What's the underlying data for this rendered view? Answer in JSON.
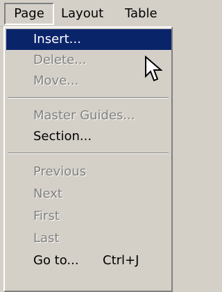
{
  "menubar": {
    "items": [
      {
        "label": "Page"
      },
      {
        "label": "Layout"
      },
      {
        "label": "Table"
      }
    ]
  },
  "menu": {
    "items": [
      {
        "label": "Insert...",
        "state": "highlighted"
      },
      {
        "label": "Delete...",
        "state": "disabled"
      },
      {
        "label": "Move...",
        "state": "disabled"
      },
      {
        "label": "Master Guides...",
        "state": "disabled"
      },
      {
        "label": "Section...",
        "state": "enabled"
      },
      {
        "label": "Previous",
        "state": "disabled"
      },
      {
        "label": "Next",
        "state": "disabled"
      },
      {
        "label": "First",
        "state": "disabled"
      },
      {
        "label": "Last",
        "state": "disabled"
      },
      {
        "label": "Go to...",
        "shortcut": "Ctrl+J",
        "state": "enabled"
      }
    ]
  },
  "colors": {
    "menu_background": "#d4d0c8",
    "highlight_background": "#0a246a",
    "highlight_text": "#ffffff",
    "disabled_text": "#808080"
  },
  "icons": {
    "cursor": "mouse-pointer-icon"
  }
}
